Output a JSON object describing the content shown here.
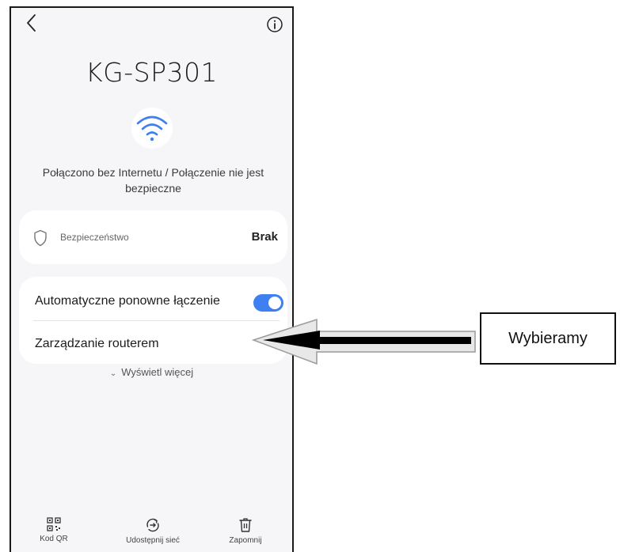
{
  "network": {
    "ssid": "KG-SP301",
    "status": "Połączono bez Internetu / Połączenie nie jest bezpieczne"
  },
  "security": {
    "label": "Bezpieczeństwo",
    "value": "Brak"
  },
  "options": {
    "auto_reconnect_label": "Automatyczne ponowne łączenie",
    "auto_reconnect_enabled": true,
    "router_management_label": "Zarządzanie routerem"
  },
  "more_label": "Wyświetl więcej",
  "bottom_bar": {
    "qr_label": "Kod QR",
    "share_label": "Udostępnij sieć",
    "forget_label": "Zapomnij"
  },
  "annotation": {
    "callout_text": "Wybieramy"
  },
  "colors": {
    "accent": "#3e80f1",
    "card_background": "#ffffff",
    "screen_background": "#f6f6f8"
  },
  "icons": [
    "back-icon",
    "info-icon",
    "wifi-icon",
    "shield-icon",
    "qr-code-icon",
    "share-icon",
    "trash-icon"
  ]
}
